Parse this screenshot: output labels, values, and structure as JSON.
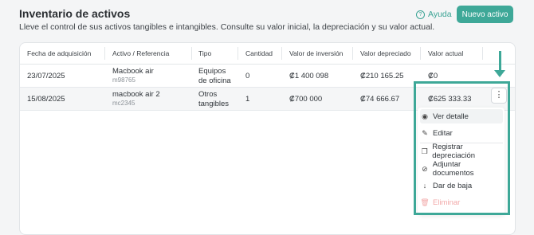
{
  "header": {
    "title": "Inventario de activos",
    "subtitle": "Lleve el control de sus activos tangibles e intangibles. Consulte su valor inicial, la depreciación y su valor actual.",
    "help_label": "Ayuda",
    "new_button": "Nuevo activo"
  },
  "table": {
    "columns": [
      "Fecha de adquisición",
      "Activo / Referencia",
      "Tipo",
      "Cantidad",
      "Valor de inversión",
      "Valor depreciado",
      "Valor actual"
    ],
    "rows": [
      {
        "date": "23/07/2025",
        "asset": "Macbook air",
        "ref": "m98765",
        "type1": "Equipos",
        "type2": "de oficina",
        "qty": "0",
        "investment": "₡1 400 098",
        "depreciated": "₡210 165.25",
        "current": "₡0"
      },
      {
        "date": "15/08/2025",
        "asset": "macbook air 2",
        "ref": "mc2345",
        "type1": "Otros",
        "type2": "tangibles",
        "qty": "1",
        "investment": "₡700 000",
        "depreciated": "₡74 666.67",
        "current": "₡625 333.33"
      }
    ]
  },
  "menu": {
    "items": [
      {
        "label": "Ver detalle",
        "icon": "eye-icon"
      },
      {
        "label": "Editar",
        "icon": "edit-icon"
      },
      {
        "label": "Registrar depreciación",
        "icon": "copy-icon"
      },
      {
        "label": "Adjuntar documentos",
        "icon": "paperclip-icon"
      },
      {
        "label": "Dar de baja",
        "icon": "arrow-down-icon"
      },
      {
        "label": "Eliminar",
        "icon": "trash-icon"
      }
    ]
  },
  "colors": {
    "accent": "#3ea898",
    "danger_disabled": "#f2a9a9"
  }
}
